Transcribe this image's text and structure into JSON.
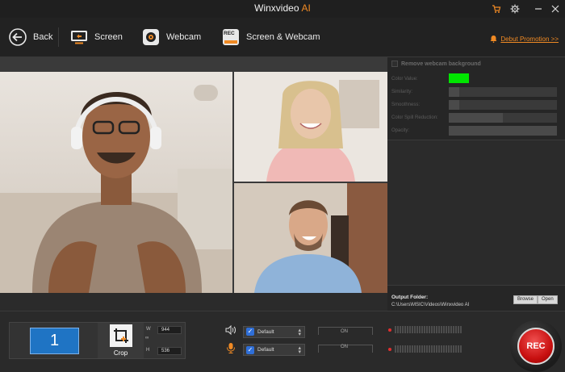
{
  "window": {
    "title": "Winxvideo",
    "title_accent": "AI",
    "controls": [
      "cart-icon",
      "settings-icon",
      "minimize-icon",
      "close-icon"
    ]
  },
  "toolbar": {
    "back_label": "Back",
    "screen_label": "Screen",
    "webcam_label": "Webcam",
    "screen_webcam_label": "Screen & Webcam",
    "promo_label": "Debut Promotion >>",
    "rec_badge": "REC"
  },
  "webcam_settings": {
    "remove_background_label": "Remove webcam background",
    "remove_background_checked": false,
    "color_value_label": "Color Value:",
    "color_value": "#00e600",
    "similarity_label": "Similarity:",
    "similarity": 0.1,
    "smoothness_label": "Smoothness:",
    "smoothness": 0.1,
    "color_spill_label": "Color Spill Reduction:",
    "color_spill": 0.5,
    "opacity_label": "Opacity:",
    "opacity": 1.0
  },
  "output": {
    "label": "Output Folder:",
    "path": "C:\\Users\\MSIC\\Videos\\Winxvideo AI",
    "browse_label": "Browse",
    "open_label": "Open"
  },
  "capture": {
    "monitor_number": "1",
    "crop_label": "Crop",
    "w_label": "W",
    "h_label": "H",
    "width": "944",
    "height": "536"
  },
  "audio": {
    "speaker_device": "Default",
    "mic_device": "Default",
    "speaker_state": "ON",
    "mic_state": "ON",
    "speaker_checked": true,
    "mic_checked": true
  },
  "record": {
    "label": "REC"
  },
  "colors": {
    "accent": "#f08a24",
    "monitor": "#1f74c4",
    "record": "#c81010"
  }
}
